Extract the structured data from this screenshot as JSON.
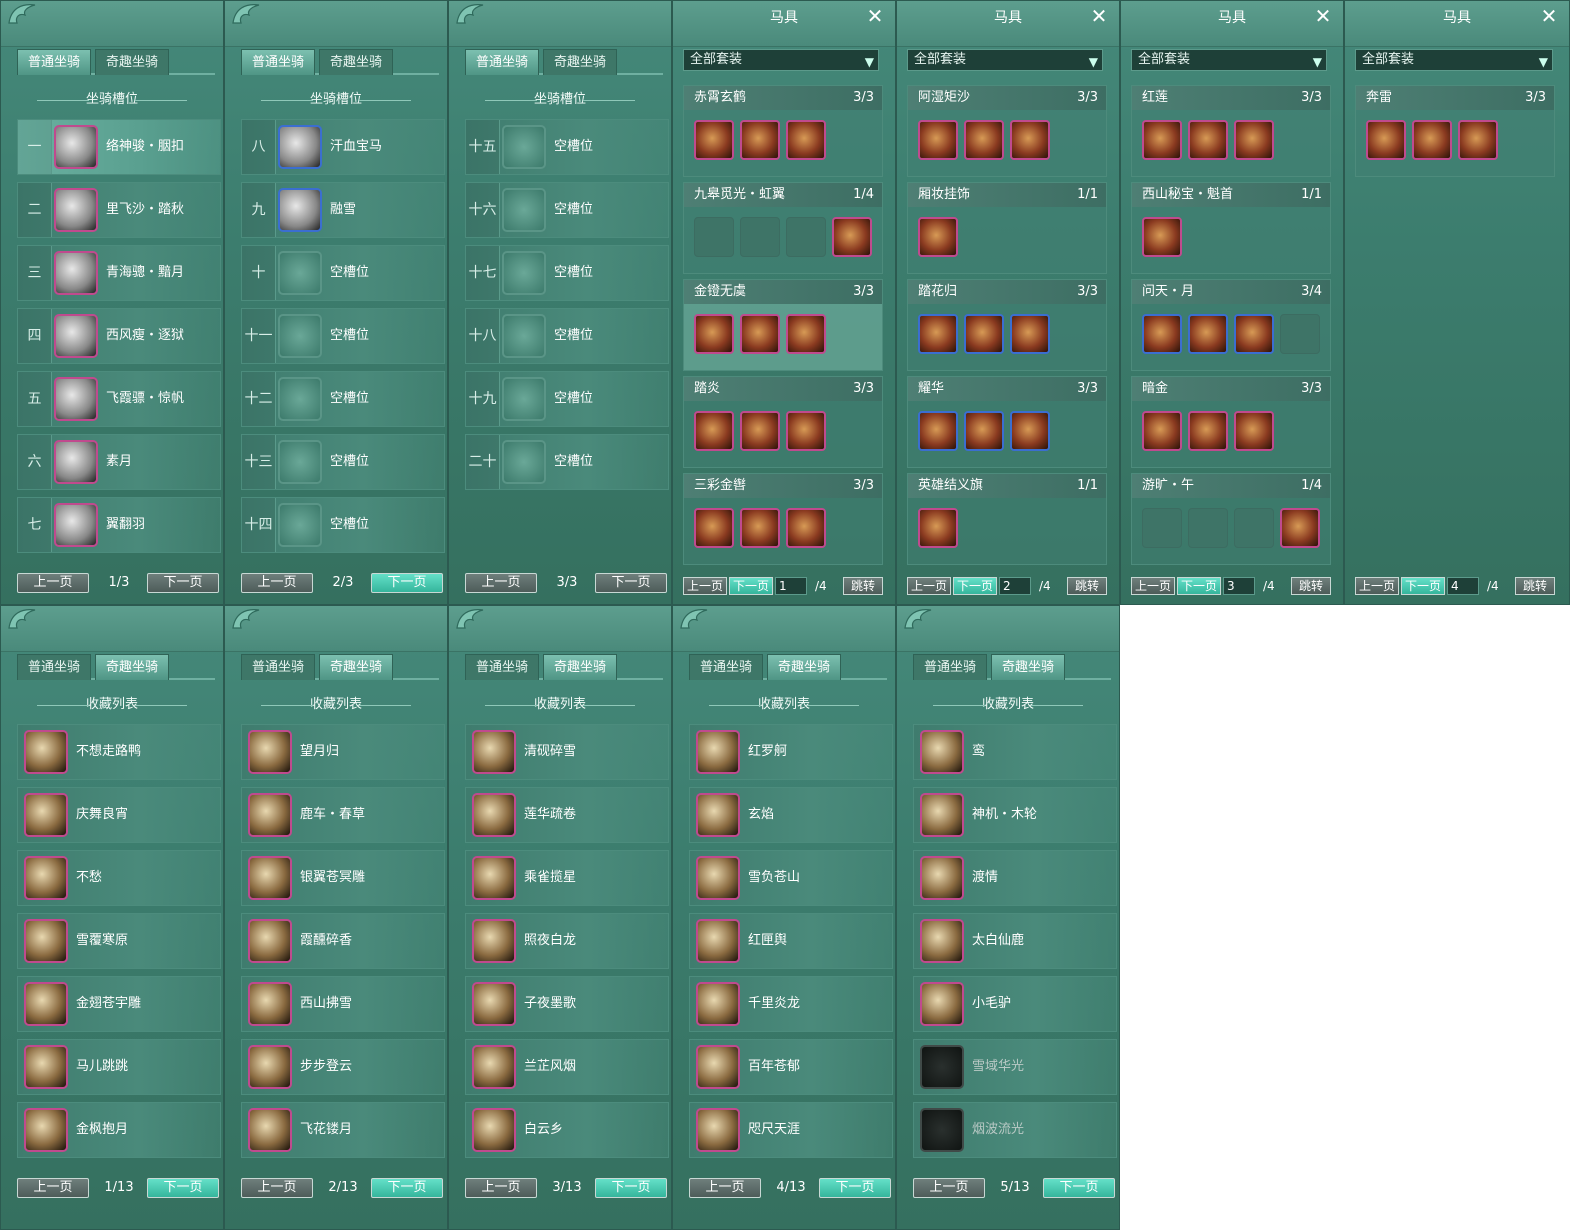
{
  "tabs": {
    "normal": "普通坐骑",
    "fun": "奇趣坐骑"
  },
  "slots_section": "坐骑槽位",
  "collection_section": "收藏列表",
  "pager": {
    "prev": "上一页",
    "next": "下一页",
    "jump": "跳转"
  },
  "slot_pages": [
    {
      "page": "1/3",
      "slots": [
        {
          "num": "一",
          "name": "络神骏・胭扣",
          "icon": "white-horse-icon"
        },
        {
          "num": "二",
          "name": "里飞沙・踏秋",
          "icon": "white-horse-icon"
        },
        {
          "num": "三",
          "name": "青海骢・黯月",
          "icon": "white-horse-icon"
        },
        {
          "num": "四",
          "name": "西风瘦・逐狱",
          "icon": "black-horse-icon"
        },
        {
          "num": "五",
          "name": "飞霞骠・惊帆",
          "icon": "white-horse-icon"
        },
        {
          "num": "六",
          "name": "素月",
          "icon": "white-horse-icon"
        },
        {
          "num": "七",
          "name": "翼翻羽",
          "icon": "black-horse-icon"
        }
      ]
    },
    {
      "page": "2/3",
      "slots": [
        {
          "num": "八",
          "name": "汗血宝马",
          "icon": "brown-horse-icon"
        },
        {
          "num": "九",
          "name": "融雪",
          "icon": "white-horse-icon"
        },
        {
          "num": "十",
          "name": "空槽位",
          "icon": "empty-slot-icon"
        },
        {
          "num": "十一",
          "name": "空槽位",
          "icon": "empty-slot-icon"
        },
        {
          "num": "十二",
          "name": "空槽位",
          "icon": "empty-slot-icon"
        },
        {
          "num": "十三",
          "name": "空槽位",
          "icon": "empty-slot-icon"
        },
        {
          "num": "十四",
          "name": "空槽位",
          "icon": "empty-slot-icon"
        }
      ]
    },
    {
      "page": "3/3",
      "slots": [
        {
          "num": "十五",
          "name": "空槽位",
          "icon": "empty-slot-icon"
        },
        {
          "num": "十六",
          "name": "空槽位",
          "icon": "empty-slot-icon"
        },
        {
          "num": "十七",
          "name": "空槽位",
          "icon": "empty-slot-icon"
        },
        {
          "num": "十八",
          "name": "空槽位",
          "icon": "empty-slot-icon"
        },
        {
          "num": "十九",
          "name": "空槽位",
          "icon": "empty-slot-icon"
        },
        {
          "num": "二十",
          "name": "空槽位",
          "icon": "empty-slot-icon"
        }
      ]
    }
  ],
  "gear": {
    "title": "马具",
    "filter": "全部套装",
    "total": "/4",
    "pages": [
      {
        "page": "1",
        "sets": [
          {
            "name": "赤霄玄鹤",
            "count": "3/3",
            "items": [
              "saddle",
              "saddle",
              "saddle"
            ]
          },
          {
            "name": "九皋觅光・虹翼",
            "count": "1/4",
            "items": [
              "empty",
              "empty",
              "empty",
              "wing"
            ]
          },
          {
            "name": "金镫无虞",
            "count": "3/3",
            "items": [
              "stirrup",
              "saddle",
              "saddle"
            ]
          },
          {
            "name": "踏炎",
            "count": "3/3",
            "items": [
              "saddle",
              "saddle",
              "saddle"
            ]
          },
          {
            "name": "三彩金辔",
            "count": "3/3",
            "items": [
              "bridle",
              "saddle",
              "saddle"
            ]
          }
        ]
      },
      {
        "page": "2",
        "sets": [
          {
            "name": "阿湿矩沙",
            "count": "3/3",
            "items": [
              "saddle",
              "saddle",
              "saddle"
            ]
          },
          {
            "name": "厢妆挂饰",
            "count": "1/1",
            "items": [
              "ornament"
            ]
          },
          {
            "name": "踏花归",
            "count": "3/3",
            "items": [
              "saddle",
              "saddle",
              "saddle"
            ]
          },
          {
            "name": "耀华",
            "count": "3/3",
            "items": [
              "saddle",
              "saddle",
              "saddle"
            ]
          },
          {
            "name": "英雄结义旗",
            "count": "1/1",
            "items": [
              "flag"
            ]
          }
        ]
      },
      {
        "page": "3",
        "sets": [
          {
            "name": "红莲",
            "count": "3/3",
            "items": [
              "saddle",
              "saddle",
              "saddle"
            ]
          },
          {
            "name": "西山秘宝・魁首",
            "count": "1/1",
            "items": [
              "ornament"
            ]
          },
          {
            "name": "问天・月",
            "count": "3/4",
            "items": [
              "armor",
              "armor",
              "armor",
              "empty"
            ]
          },
          {
            "name": "暗金",
            "count": "3/3",
            "items": [
              "saddle",
              "saddle",
              "saddle"
            ]
          },
          {
            "name": "游旷・午",
            "count": "1/4",
            "items": [
              "empty",
              "empty",
              "empty",
              "armor"
            ]
          }
        ]
      },
      {
        "page": "4",
        "sets": [
          {
            "name": "奔雷",
            "count": "3/3",
            "items": [
              "saddle",
              "saddle",
              "saddle"
            ]
          }
        ]
      }
    ]
  },
  "collection_pages": [
    {
      "page": "1/13",
      "items": [
        "不想走路鸭",
        "庆舞良宵",
        "不愁",
        "雪覆寒原",
        "金翅苍宇雕",
        "马儿跳跳",
        "金枫抱月"
      ]
    },
    {
      "page": "2/13",
      "items": [
        "望月归",
        "鹿车・春草",
        "银翼苍冥雕",
        "霞醺碎香",
        "西山拂雪",
        "步步登云",
        "飞花镂月"
      ]
    },
    {
      "page": "3/13",
      "items": [
        "清砚碎雪",
        "莲华疏卷",
        "乘雀揽星",
        "照夜白龙",
        "子夜墨歌",
        "兰芷风烟",
        "白云乡"
      ]
    },
    {
      "page": "4/13",
      "items": [
        "红罗舸",
        "玄焰",
        "雪负苍山",
        "红匣舆",
        "千里炎龙",
        "百年苍郁",
        "咫尺天涯"
      ]
    },
    {
      "page": "5/13",
      "items": [
        "鸾",
        "神机・木轮",
        "渡情",
        "太白仙鹿",
        "小毛驴",
        "雪域华光",
        "烟波流光"
      ]
    }
  ],
  "colors": {
    "accent": "#5fd6bd",
    "rare_border": "#c04a8e",
    "blue_border": "#3b6ed0"
  }
}
